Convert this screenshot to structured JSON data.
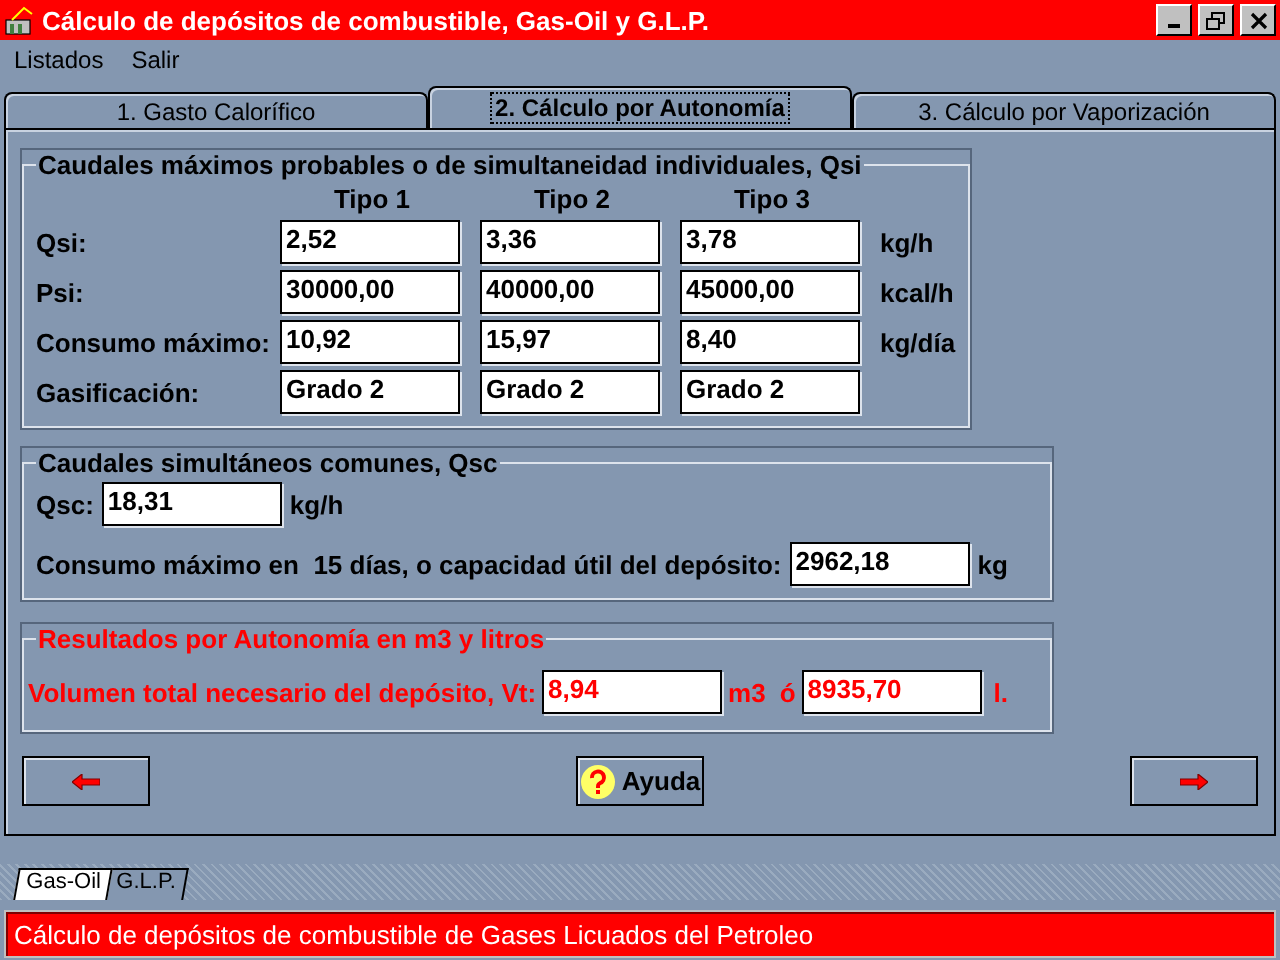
{
  "window": {
    "title": "Cálculo de depósitos de combustible, Gas-Oil y G.L.P."
  },
  "menu": [
    "Listados",
    "Salir"
  ],
  "tabs": [
    {
      "label": "1. Gasto Calorífico",
      "selected": false
    },
    {
      "label": "2. Cálculo por Autonomía",
      "selected": true
    },
    {
      "label": "3. Cálculo por Vaporización",
      "selected": false
    }
  ],
  "individual": {
    "title": "Caudales máximos probables o de simultaneidad individuales, Qsi",
    "columns": [
      "Tipo 1",
      "Tipo 2",
      "Tipo 3"
    ],
    "rows": [
      {
        "label": "Qsi:",
        "values": [
          "2,52",
          "3,36",
          "3,78"
        ],
        "unit": "kg/h"
      },
      {
        "label": "Psi:",
        "values": [
          "30000,00",
          "40000,00",
          "45000,00"
        ],
        "unit": "kcal/h"
      },
      {
        "label": "Consumo máximo:",
        "values": [
          "10,92",
          "15,97",
          "8,40"
        ],
        "unit": "kg/día"
      },
      {
        "label": "Gasificación:",
        "values": [
          "Grado 2",
          "Grado 2",
          "Grado 2"
        ]
      }
    ]
  },
  "common": {
    "title": "Caudales simultáneos comunes, Qsc",
    "qsc": {
      "label": "Qsc:",
      "value": "18,31",
      "unit": "kg/h"
    },
    "capacity": {
      "label": "Consumo máximo en  15 días, o capacidad útil del depósito:",
      "value": "2962,18",
      "unit": "kg"
    }
  },
  "results": {
    "title": "Resultados por Autonomía en m3 y litros",
    "label": "Volumen total necesario del depósito, Vt:",
    "volume_m3": "8,94",
    "unit_m3": "m3",
    "separator": "ó",
    "volume_l": "8935,70",
    "unit_l": "l."
  },
  "buttons": [
    {
      "kind": "back"
    },
    {
      "kind": "help",
      "label": "Ayuda"
    },
    {
      "kind": "forward"
    }
  ],
  "sheet_tabs": [
    {
      "label": "Gas-Oil",
      "selected": true
    },
    {
      "label": "G.L.P.",
      "selected": false
    }
  ],
  "status_bar": "Cálculo de depósitos de combustible de Gases Licuados del Petroleo"
}
